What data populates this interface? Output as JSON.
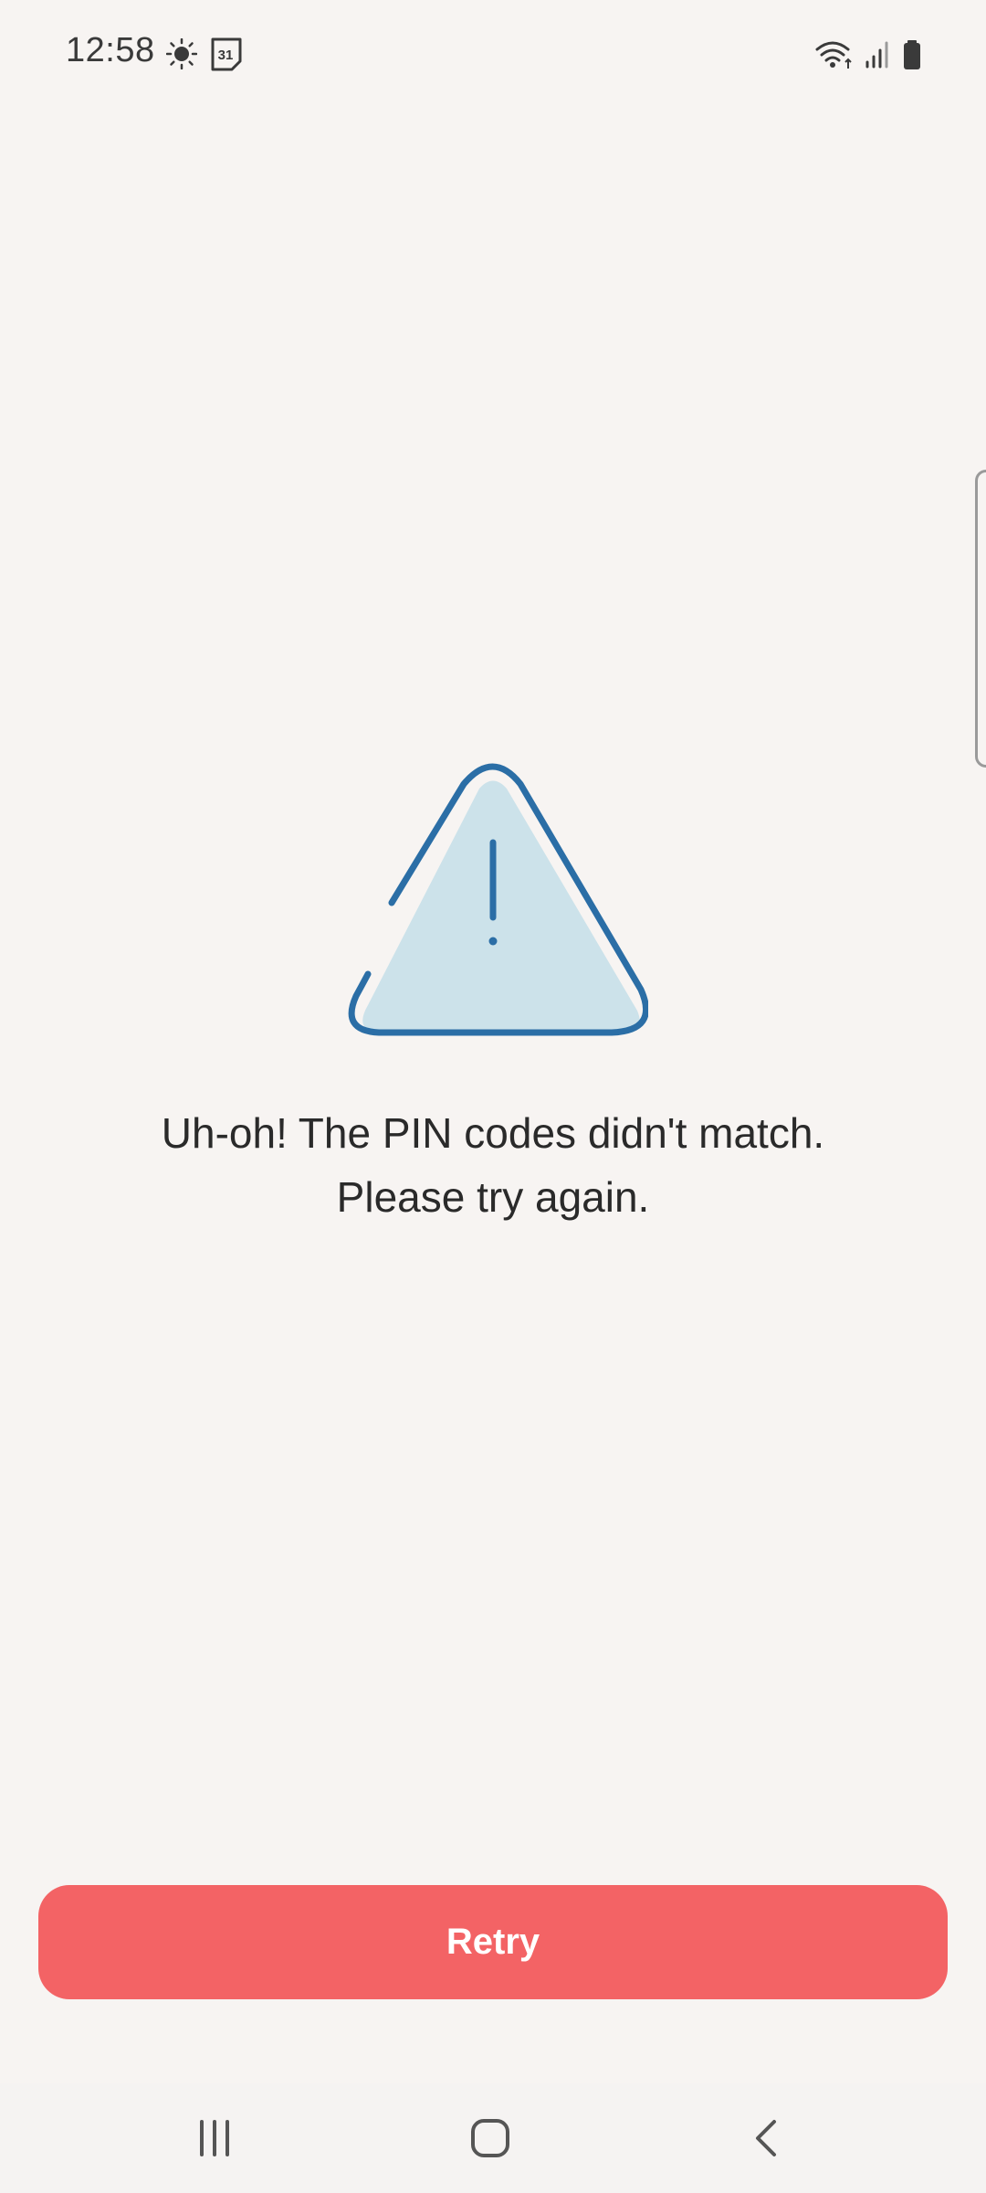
{
  "status_bar": {
    "time": "12:58",
    "icons": [
      "brightness-icon",
      "calendar-icon",
      "wifi-icon",
      "signal-icon",
      "battery-icon"
    ],
    "calendar_day": "31"
  },
  "error": {
    "icon": "warning-triangle-icon",
    "message_line1": "Uh-oh! The PIN codes didn't match.",
    "message_line2": "Please try again."
  },
  "actions": {
    "retry_label": "Retry"
  },
  "navigation": {
    "icons": [
      "recent-apps-icon",
      "home-icon",
      "back-icon"
    ]
  },
  "colors": {
    "background": "#f7f4f2",
    "accent": "#f36365",
    "icon_stroke": "#2b6ea6",
    "icon_fill": "#cce2ea"
  }
}
